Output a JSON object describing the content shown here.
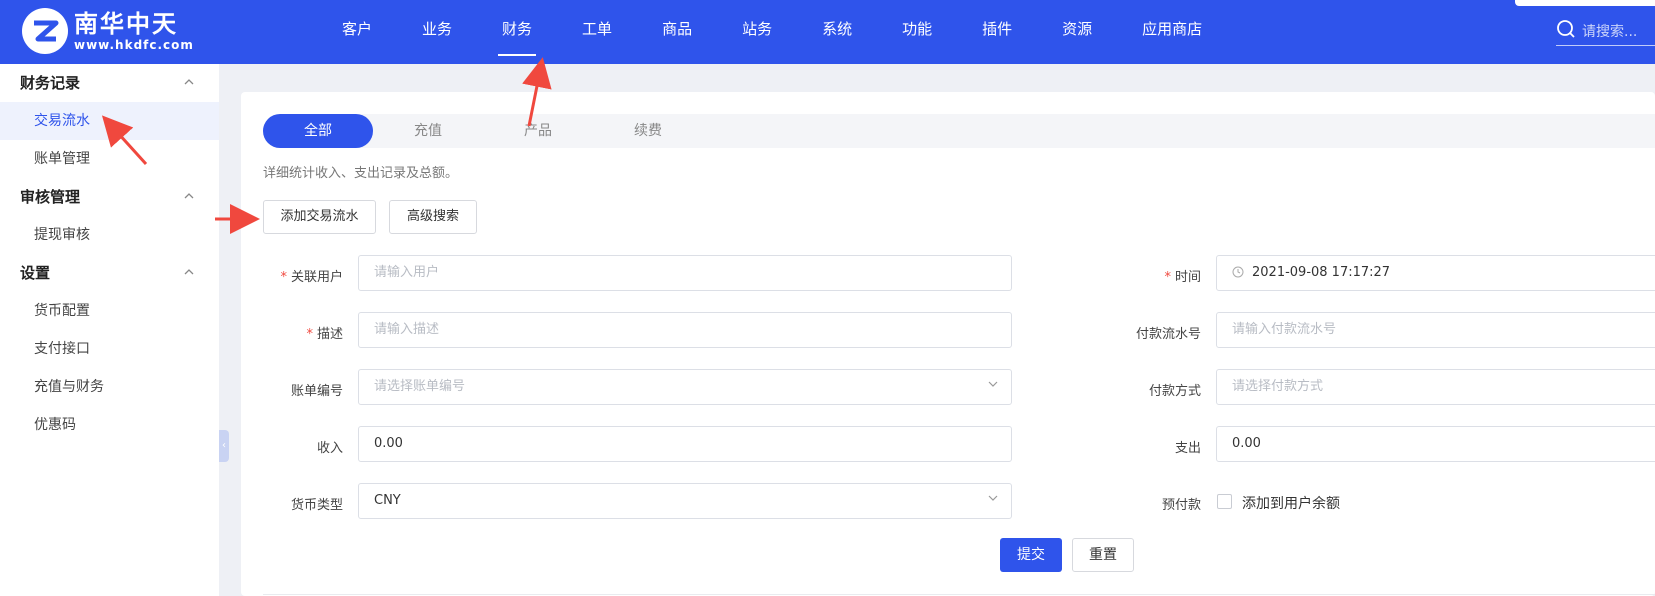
{
  "brand": {
    "name": "南华中天",
    "url": "www.hkdfc.com"
  },
  "nav": [
    {
      "label": "客户"
    },
    {
      "label": "业务"
    },
    {
      "label": "财务"
    },
    {
      "label": "工单"
    },
    {
      "label": "商品"
    },
    {
      "label": "站务"
    },
    {
      "label": "系统"
    },
    {
      "label": "功能"
    },
    {
      "label": "插件"
    },
    {
      "label": "资源"
    },
    {
      "label": "应用商店"
    }
  ],
  "nav_active": "财务",
  "search": {
    "placeholder": "请搜索..."
  },
  "sidebar": {
    "groups": [
      {
        "title": "财务记录",
        "items": [
          {
            "label": "交易流水",
            "active": true
          },
          {
            "label": "账单管理"
          }
        ]
      },
      {
        "title": "审核管理",
        "items": [
          {
            "label": "提现审核"
          }
        ]
      },
      {
        "title": "设置",
        "items": [
          {
            "label": "货币配置"
          },
          {
            "label": "支付接口"
          },
          {
            "label": "充值与财务"
          },
          {
            "label": "优惠码"
          }
        ]
      }
    ]
  },
  "tabs": [
    {
      "label": "全部"
    },
    {
      "label": "充值"
    },
    {
      "label": "产品"
    },
    {
      "label": "续费"
    }
  ],
  "description": "详细统计收入、支出记录及总额。",
  "actions": {
    "add": "添加交易流水",
    "advanced_search": "高级搜索"
  },
  "form": {
    "user": {
      "label": "关联用户",
      "placeholder": "请输入用户"
    },
    "time": {
      "label": "时间",
      "value": "2021-09-08 17:17:27"
    },
    "desc": {
      "label": "描述",
      "placeholder": "请输入描述"
    },
    "pay_serial": {
      "label": "付款流水号",
      "placeholder": "请输入付款流水号"
    },
    "invoice": {
      "label": "账单编号",
      "placeholder": "请选择账单编号"
    },
    "pay_method": {
      "label": "付款方式",
      "placeholder": "请选择付款方式"
    },
    "income": {
      "label": "收入",
      "value": "0.00"
    },
    "expense": {
      "label": "支出",
      "value": "0.00"
    },
    "currency": {
      "label": "货币类型",
      "value": "CNY"
    },
    "prepay": {
      "label": "预付款",
      "checkbox_label": "添加到用户余额"
    },
    "submit": "提交",
    "reset": "重置"
  },
  "colors": {
    "primary": "#2f54eb",
    "annotation_arrow": "#f0483e"
  }
}
